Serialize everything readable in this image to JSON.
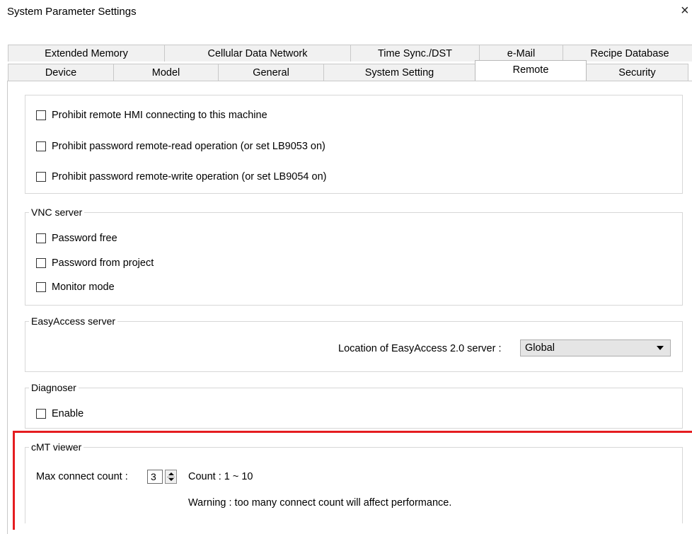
{
  "window": {
    "title": "System Parameter Settings",
    "close_glyph": "×"
  },
  "tabs_row1": [
    "Extended Memory",
    "Cellular Data Network",
    "Time Sync./DST",
    "e-Mail",
    "Recipe Database"
  ],
  "tabs_row2": [
    "Device",
    "Model",
    "General",
    "System Setting",
    "Remote",
    "Security"
  ],
  "active_tab": "Remote",
  "remote_prohibit": {
    "items": [
      {
        "label": "Prohibit remote HMI connecting to this machine",
        "checked": false
      },
      {
        "label": "Prohibit password remote-read operation (or set LB9053 on)",
        "checked": false
      },
      {
        "label": "Prohibit password remote-write operation (or set LB9054 on)",
        "checked": false
      }
    ]
  },
  "vnc_server": {
    "legend": "VNC server",
    "items": [
      {
        "label": "Password free",
        "checked": false
      },
      {
        "label": "Password from project",
        "checked": false
      },
      {
        "label": "Monitor mode",
        "checked": false
      }
    ]
  },
  "easyaccess": {
    "legend": "EasyAccess server",
    "location_label": "Location of EasyAccess 2.0 server :",
    "location_value": "Global"
  },
  "diagnoser": {
    "legend": "Diagnoser",
    "enable_label": "Enable",
    "enable_checked": false
  },
  "cmt_viewer": {
    "legend": "cMT viewer",
    "max_label": "Max connect count :",
    "max_value": "3",
    "count_range": "Count : 1 ~ 10",
    "warning": "Warning : too many connect count will affect performance."
  },
  "colors": {
    "highlight_border": "#e51d20"
  }
}
